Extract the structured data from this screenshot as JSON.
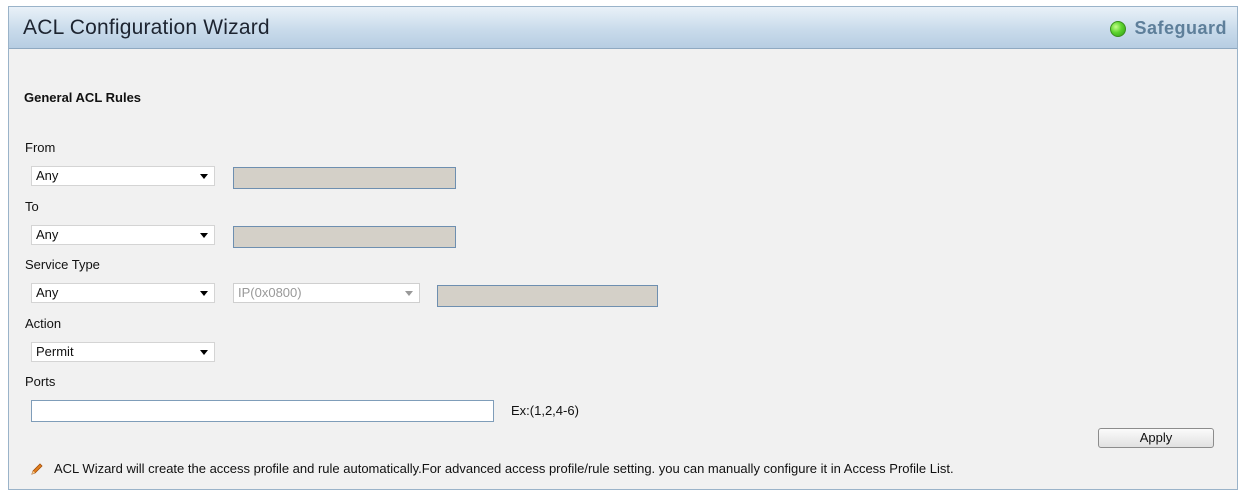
{
  "header": {
    "title": "ACL Configuration Wizard",
    "safeguard_label": "Safeguard",
    "safeguard_icon": "green-status-led",
    "safeguard_color": "#4cc324"
  },
  "section_title": "General ACL Rules",
  "from": {
    "label": "From",
    "selected": "Any"
  },
  "to": {
    "label": "To",
    "selected": "Any"
  },
  "service_type": {
    "label": "Service Type",
    "selected": "Any",
    "ethertype_selected": "IP(0x0800)"
  },
  "action": {
    "label": "Action",
    "selected": "Permit"
  },
  "ports": {
    "label": "Ports",
    "value": "",
    "hint": "Ex:(1,2,4-6)"
  },
  "apply_label": "Apply",
  "note": {
    "icon": "pencil-icon",
    "text": "ACL Wizard will create the access profile and rule automatically.For advanced access profile/rule setting. you can manually configure it in Access Profile List."
  }
}
